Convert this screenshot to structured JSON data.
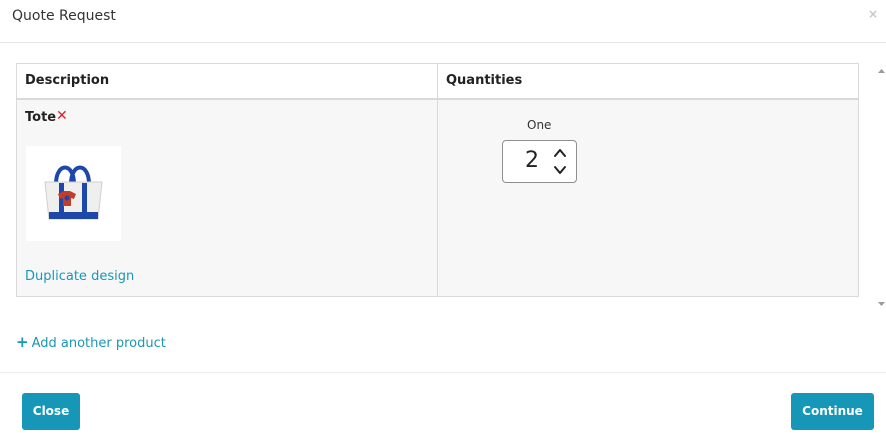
{
  "dialog": {
    "title": "Quote Request",
    "close_glyph": "×"
  },
  "table": {
    "headers": [
      "Description",
      "Quantities"
    ],
    "rows": [
      {
        "product_name": "Tote",
        "remove_glyph": "✕",
        "thumbnail_icon": "tote-bag-image",
        "duplicate_link": "Duplicate design",
        "quantity_label": "One",
        "quantity_value": "2"
      }
    ]
  },
  "add_product": {
    "icon": "plus-icon",
    "label": "Add another product"
  },
  "footer": {
    "close_label": "Close",
    "continue_label": "Continue"
  },
  "colors": {
    "accent": "#1797b8",
    "link": "#1a97b4",
    "remove": "#d9222a"
  }
}
